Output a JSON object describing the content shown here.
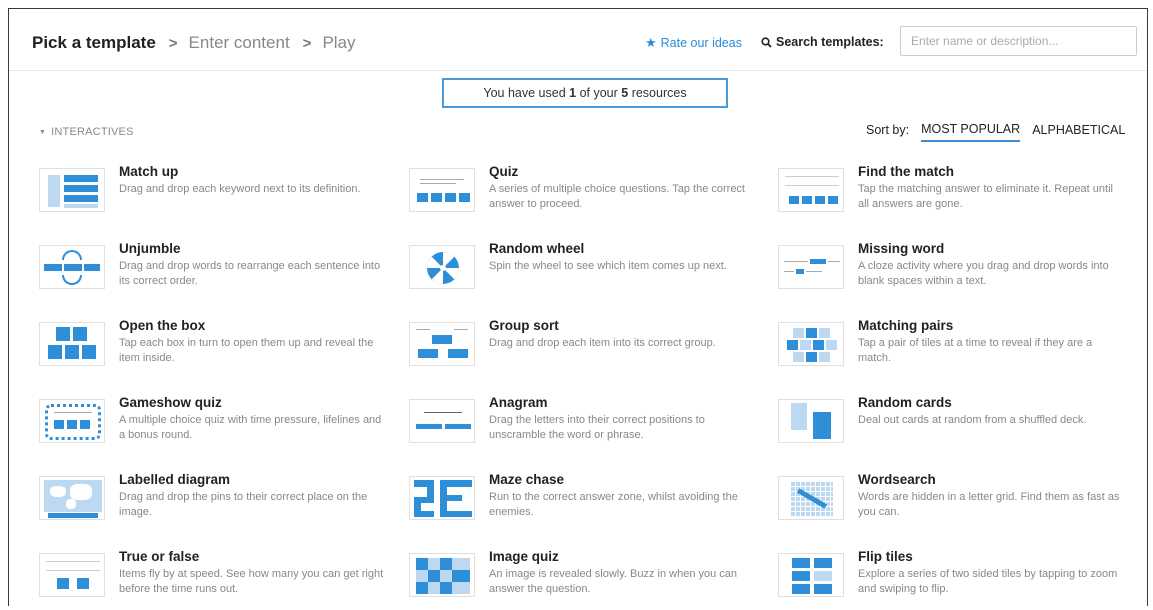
{
  "header": {
    "breadcrumbs": [
      "Pick a template",
      "Enter content",
      "Play"
    ],
    "separator": ">",
    "rate_label": "Rate our ideas",
    "search_label": "Search templates:",
    "search_placeholder": "Enter name or description..."
  },
  "usage": {
    "prefix": "You have used ",
    "used": "1",
    "middle": " of your ",
    "total": "5",
    "suffix": " resources"
  },
  "section": {
    "label": "INTERACTIVES",
    "sort_label": "Sort by:",
    "sort_options": [
      "MOST POPULAR",
      "ALPHABETICAL"
    ],
    "sort_selected": "MOST POPULAR"
  },
  "templates": [
    {
      "title": "Match up",
      "desc": "Drag and drop each keyword next to its definition.",
      "icon": "match-up"
    },
    {
      "title": "Quiz",
      "desc": "A series of multiple choice questions. Tap the correct answer to proceed.",
      "icon": "quiz"
    },
    {
      "title": "Find the match",
      "desc": "Tap the matching answer to eliminate it. Repeat until all answers are gone.",
      "icon": "find-the-match"
    },
    {
      "title": "Unjumble",
      "desc": "Drag and drop words to rearrange each sentence into its correct order.",
      "icon": "unjumble"
    },
    {
      "title": "Random wheel",
      "desc": "Spin the wheel to see which item comes up next.",
      "icon": "random-wheel"
    },
    {
      "title": "Missing word",
      "desc": "A cloze activity where you drag and drop words into blank spaces within a text.",
      "icon": "missing-word"
    },
    {
      "title": "Open the box",
      "desc": "Tap each box in turn to open them up and reveal the item inside.",
      "icon": "open-the-box"
    },
    {
      "title": "Group sort",
      "desc": "Drag and drop each item into its correct group.",
      "icon": "group-sort"
    },
    {
      "title": "Matching pairs",
      "desc": "Tap a pair of tiles at a time to reveal if they are a match.",
      "icon": "matching-pairs"
    },
    {
      "title": "Gameshow quiz",
      "desc": "A multiple choice quiz with time pressure, lifelines and a bonus round.",
      "icon": "gameshow-quiz"
    },
    {
      "title": "Anagram",
      "desc": "Drag the letters into their correct positions to unscramble the word or phrase.",
      "icon": "anagram"
    },
    {
      "title": "Random cards",
      "desc": "Deal out cards at random from a shuffled deck.",
      "icon": "random-cards"
    },
    {
      "title": "Labelled diagram",
      "desc": "Drag and drop the pins to their correct place on the image.",
      "icon": "labelled-diagram"
    },
    {
      "title": "Maze chase",
      "desc": "Run to the correct answer zone, whilst avoiding the enemies.",
      "icon": "maze-chase"
    },
    {
      "title": "Wordsearch",
      "desc": "Words are hidden in a letter grid. Find them as fast as you can.",
      "icon": "wordsearch"
    },
    {
      "title": "True or false",
      "desc": "Items fly by at speed. See how many you can get right before the time runs out.",
      "icon": "true-or-false"
    },
    {
      "title": "Image quiz",
      "desc": "An image is revealed slowly. Buzz in when you can answer the question.",
      "icon": "image-quiz"
    },
    {
      "title": "Flip tiles",
      "desc": "Explore a series of two sided tiles by tapping to zoom and swiping to flip.",
      "icon": "flip-tiles"
    }
  ],
  "colors": {
    "accent": "#2f8ed8",
    "accent_light": "#bcd9f1",
    "banner_border": "#4a9ad8"
  }
}
